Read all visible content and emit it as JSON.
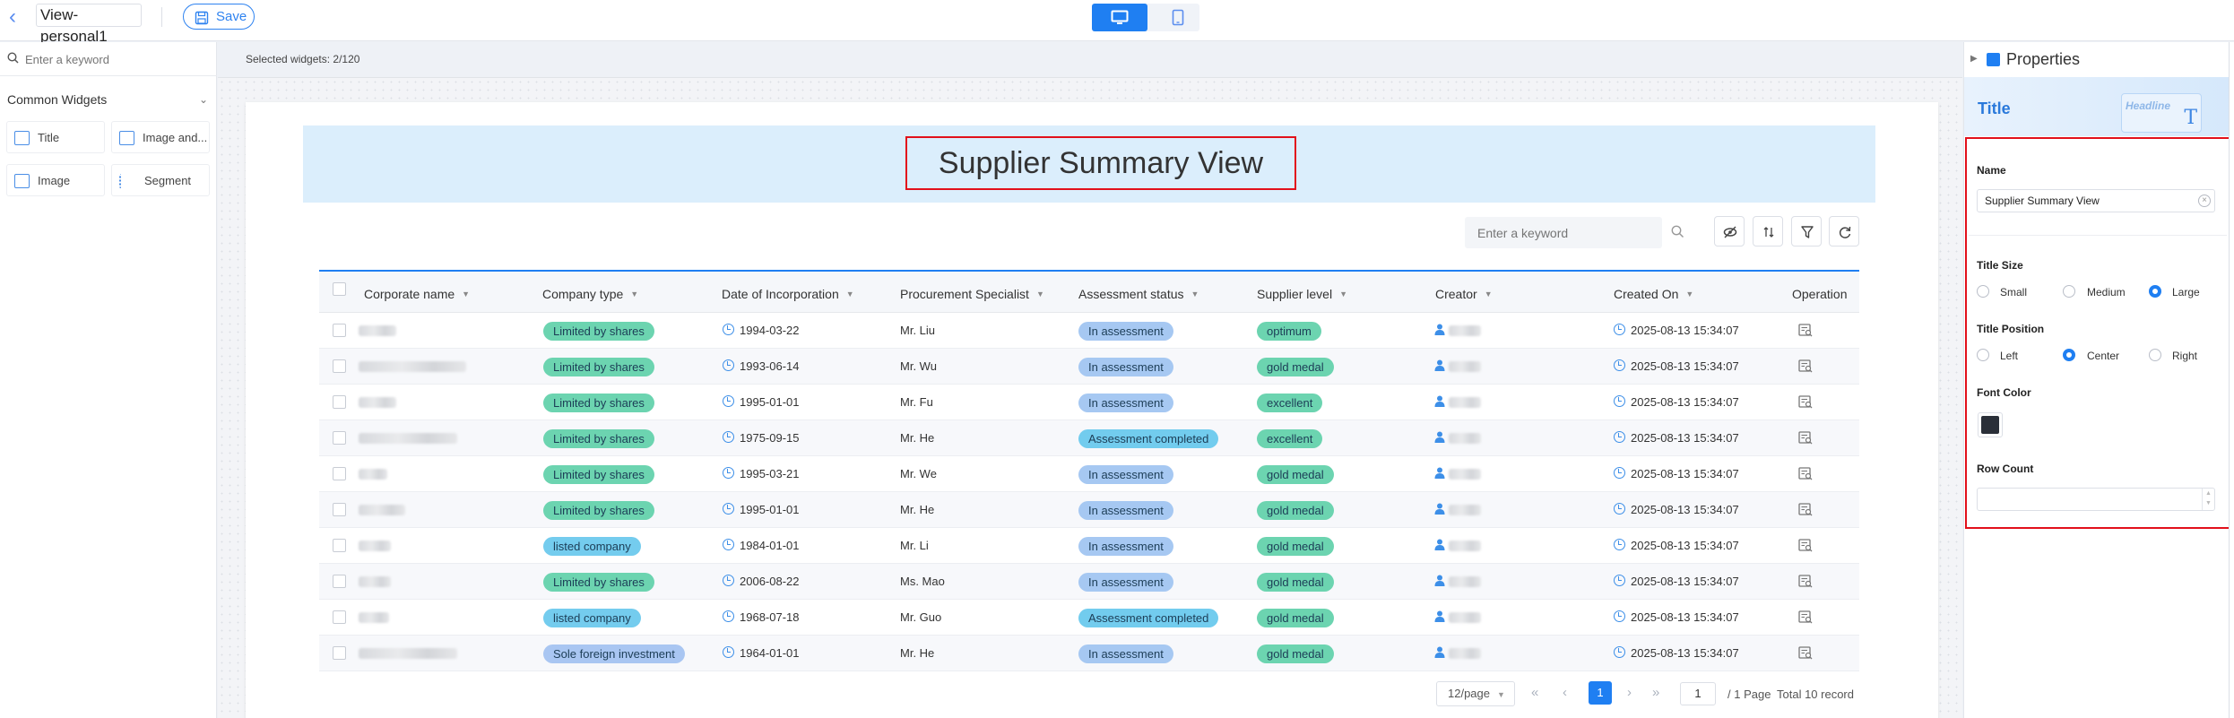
{
  "topbar": {
    "view_name": "View-personal1",
    "save_label": "Save"
  },
  "left_panel": {
    "search_placeholder": "Enter a keyword",
    "section_title": "Common Widgets",
    "widgets": [
      {
        "label": "Title",
        "icon": "title-widget-icon"
      },
      {
        "label": "Image and...",
        "icon": "image-text-widget-icon"
      },
      {
        "label": "Image",
        "icon": "image-widget-icon"
      },
      {
        "label": "Segment",
        "icon": "segment-widget-icon"
      }
    ]
  },
  "canvas": {
    "selected_info": "Selected widgets: 2/120",
    "title": "Supplier Summary View",
    "search_placeholder": "Enter a keyword"
  },
  "table": {
    "columns": [
      "Corporate name",
      "Company type",
      "Date of Incorporation",
      "Procurement Specialist",
      "Assessment status",
      "Supplier level",
      "Creator",
      "Created On",
      "Operation"
    ],
    "rows": [
      {
        "type": "Limited by shares",
        "date": "1994-03-22",
        "specialist": "Mr. Liu",
        "status": "In assessment",
        "level": "optimum",
        "created": "2025-08-13 15:34:07"
      },
      {
        "type": "Limited by shares",
        "date": "1993-06-14",
        "specialist": "Mr. Wu",
        "status": "In assessment",
        "level": "gold medal",
        "created": "2025-08-13 15:34:07"
      },
      {
        "type": "Limited by shares",
        "date": "1995-01-01",
        "specialist": "Mr. Fu",
        "status": "In assessment",
        "level": "excellent",
        "created": "2025-08-13 15:34:07"
      },
      {
        "type": "Limited by shares",
        "date": "1975-09-15",
        "specialist": "Mr. He",
        "status": "Assessment completed",
        "level": "excellent",
        "created": "2025-08-13 15:34:07"
      },
      {
        "type": "Limited by shares",
        "date": "1995-03-21",
        "specialist": "Mr. We",
        "status": "In assessment",
        "level": "gold medal",
        "created": "2025-08-13 15:34:07"
      },
      {
        "type": "Limited by shares",
        "date": "1995-01-01",
        "specialist": "Mr. He",
        "status": "In assessment",
        "level": "gold medal",
        "created": "2025-08-13 15:34:07"
      },
      {
        "type": "listed company",
        "date": "1984-01-01",
        "specialist": "Mr. Li",
        "status": "In assessment",
        "level": "gold medal",
        "created": "2025-08-13 15:34:07"
      },
      {
        "type": "Limited by shares",
        "date": "2006-08-22",
        "specialist": "Ms. Mao",
        "status": "In assessment",
        "level": "gold medal",
        "created": "2025-08-13 15:34:07"
      },
      {
        "type": "listed company",
        "date": "1968-07-18",
        "specialist": "Mr. Guo",
        "status": "Assessment completed",
        "level": "gold medal",
        "created": "2025-08-13 15:34:07"
      },
      {
        "type": "Sole foreign investment",
        "date": "1964-01-01",
        "specialist": "Mr. He",
        "status": "In assessment",
        "level": "gold medal",
        "created": "2025-08-13 15:34:07"
      }
    ]
  },
  "pagination": {
    "page_size": "12/page",
    "current_page": "1",
    "page_input": "1",
    "page_of": "/ 1 Page",
    "total": "Total 10 record"
  },
  "properties": {
    "panel_title": "Properties",
    "widget_title": "Title",
    "preview_text": "Headline",
    "name_label": "Name",
    "name_value": "Supplier Summary View",
    "size_label": "Title Size",
    "size_options": [
      "Small",
      "Medium",
      "Large"
    ],
    "size_selected": "Large",
    "position_label": "Title Position",
    "position_options": [
      "Left",
      "Center",
      "Right"
    ],
    "position_selected": "Center",
    "font_color_label": "Font Color",
    "font_color": "#2a2f38",
    "row_count_label": "Row Count",
    "row_count_value": ""
  },
  "colors": {
    "accent": "#1f7ff2",
    "highlight_border": "#e2101b",
    "tag_company_type": "#6cd4b0",
    "tag_listed": "#74ccee",
    "tag_sole_foreign": "#a9c6f2",
    "tag_in_assessment": "#a6c8f2",
    "tag_completed": "#72ccee",
    "tag_level": "#6cd4b0"
  }
}
